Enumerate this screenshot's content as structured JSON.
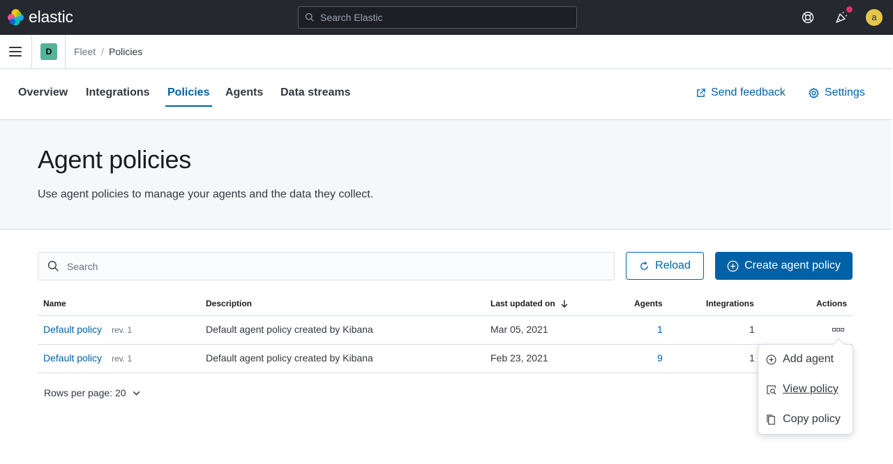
{
  "header": {
    "logo_text": "elastic",
    "search_placeholder": "Search Elastic",
    "avatar_initial": "a"
  },
  "subbar": {
    "space_initial": "D",
    "breadcrumbs": [
      "Fleet",
      "Policies"
    ],
    "separator": "/"
  },
  "tabs": {
    "items": [
      "Overview",
      "Integrations",
      "Policies",
      "Agents",
      "Data streams"
    ],
    "active": "Policies",
    "send_feedback": "Send feedback",
    "settings": "Settings"
  },
  "page": {
    "title": "Agent policies",
    "description": "Use agent policies to manage your agents and the data they collect."
  },
  "toolbar": {
    "search_placeholder": "Search",
    "reload_label": "Reload",
    "create_label": "Create agent policy"
  },
  "table": {
    "columns": [
      "Name",
      "Description",
      "Last updated on",
      "Agents",
      "Integrations",
      "Actions"
    ],
    "rows": [
      {
        "name": "Default policy",
        "rev": "rev. 1",
        "description": "Default agent policy created by Kibana",
        "updated": "Mar 05, 2021",
        "agents": "1",
        "integrations": "1"
      },
      {
        "name": "Default policy",
        "rev": "rev. 1",
        "description": "Default agent policy created by Kibana",
        "updated": "Feb 23, 2021",
        "agents": "9",
        "integrations": "1"
      }
    ]
  },
  "pagination": {
    "rows_per_page": "Rows per page: 20"
  },
  "actions_menu": {
    "items": [
      "Add agent",
      "View policy",
      "Copy policy"
    ]
  },
  "colors": {
    "header_bg": "#25282f",
    "primary": "#0061a6",
    "page_header_bg": "#f5f7fa",
    "notification": "#e2306b",
    "avatar": "#e7c547",
    "space_badge": "#54b399"
  }
}
